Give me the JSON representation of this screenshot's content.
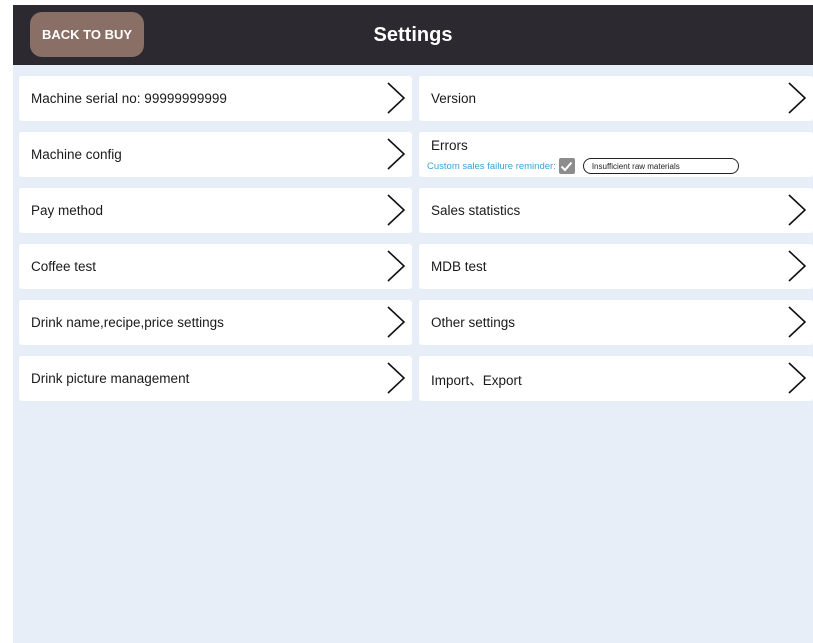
{
  "header": {
    "back_label": "BACK TO BUY",
    "title": "Settings"
  },
  "left_items": [
    {
      "label": "Machine serial no: 99999999999"
    },
    {
      "label": "Machine config"
    },
    {
      "label": "Pay method"
    },
    {
      "label": "Coffee test"
    },
    {
      "label": "Drink name,recipe,price settings"
    },
    {
      "label": "Drink picture management"
    }
  ],
  "right_items": {
    "version": "Version",
    "errors": {
      "title": "Errors",
      "reminder_label": "Custom sales failure reminder:",
      "reminder_checked": true,
      "reminder_value": "Insufficient raw materials"
    },
    "sales_statistics": "Sales statistics",
    "mdb_test": "MDB test",
    "other_settings": "Other settings",
    "import_export": "Import、Export"
  },
  "colors": {
    "header_bg": "#2c2a30",
    "back_button_bg": "#8a6f66",
    "page_bg": "#e8eef8",
    "accent_text": "#3aa3d4"
  },
  "icons": {
    "row_chevron": "chevron-right-icon",
    "checkbox": "checkmark-icon"
  }
}
